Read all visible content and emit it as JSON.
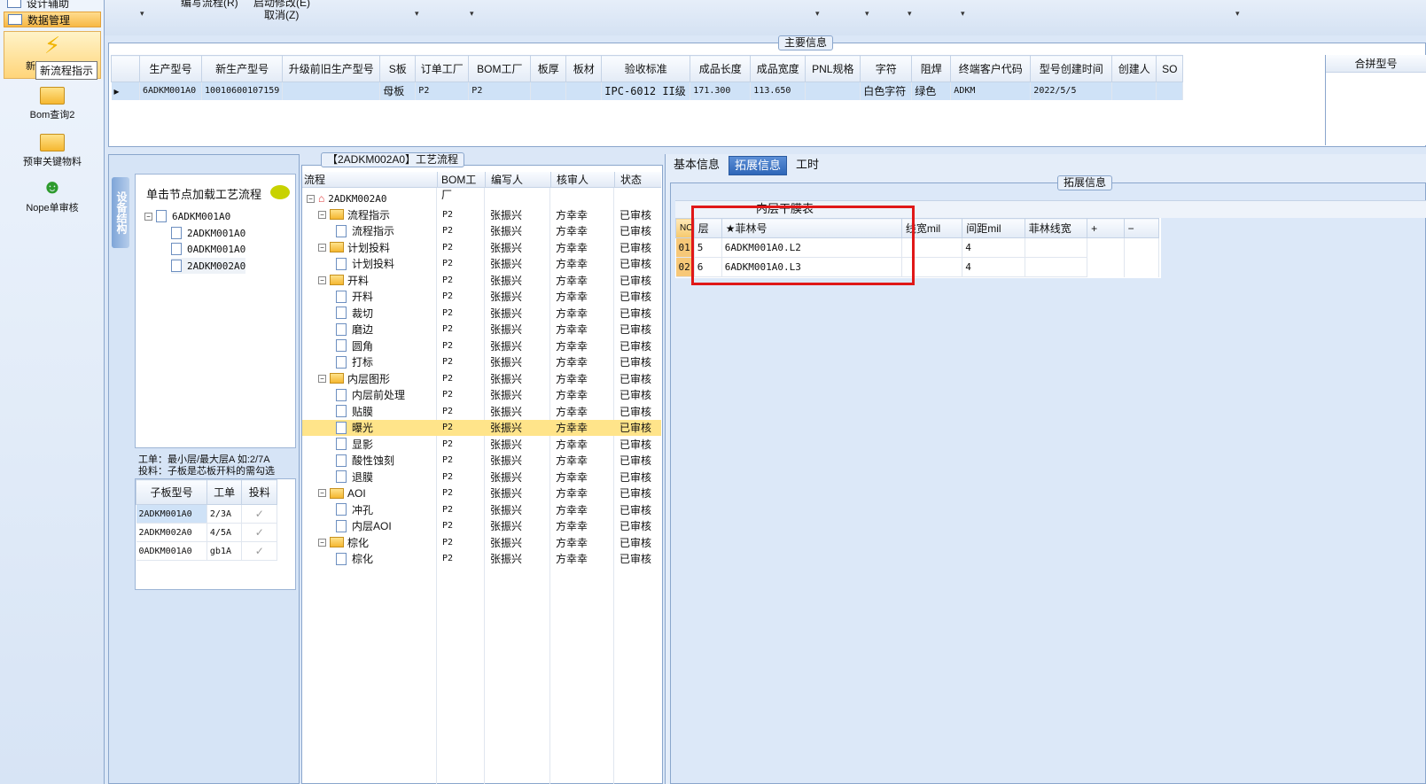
{
  "nav": {
    "top_items": [
      "设计辅助",
      "数据管理"
    ],
    "big_buttons": [
      {
        "label": "新流程指示",
        "icon": "lightning-icon"
      },
      {
        "label": "Bom查询2",
        "icon": "folder-icon"
      },
      {
        "label": "预审关键物料",
        "icon": "folder-icon"
      },
      {
        "label": "Nope单审核",
        "icon": "user-icon"
      }
    ],
    "tooltip": "新流程指示",
    "partial_label": "新"
  },
  "toolbar": {
    "item1": "编写流程(R)",
    "item2": "启动修改(E)",
    "cancel": "取消(Z)"
  },
  "main_info": {
    "title": "主要信息",
    "right_title": "合拼型号",
    "columns": [
      "生产型号",
      "新生产型号",
      "升级前旧生产型号",
      "S板",
      "订单工厂",
      "BOM工厂",
      "板厚",
      "板材",
      "验收标准",
      "成品长度",
      "成品宽度",
      "PNL规格",
      "字符",
      "阻焊",
      "终端客户代码",
      "型号创建时间",
      "创建人",
      "SO"
    ],
    "row": [
      "6ADKM001A0",
      "10010600107159",
      "",
      "母板",
      "P2",
      "P2",
      "",
      "",
      "IPC-6012 II级",
      "171.300",
      "113.650",
      "",
      "白色字符",
      "绿色",
      "ADKM",
      "2022/5/5",
      "",
      ""
    ]
  },
  "device_tree": {
    "side_tab": "设备结构",
    "hint": "单击节点加载工艺流程",
    "root": "6ADKM001A0",
    "children": [
      "2ADKM001A0",
      "0ADKM001A0",
      "2ADKM002A0"
    ],
    "note1": "工单：最小层/最大层A 如:2/7A",
    "note2": "投料：子板是芯板开料的需勾选",
    "sub_columns": [
      "子板型号",
      "工单",
      "投料"
    ],
    "sub_rows": [
      {
        "model": "2ADKM001A0",
        "order": "2/3A",
        "checked": "✓"
      },
      {
        "model": "2ADKM002A0",
        "order": "4/5A",
        "checked": "✓"
      },
      {
        "model": "0ADKM001A0",
        "order": "gb1A",
        "checked": "✓"
      }
    ]
  },
  "process": {
    "title": "【2ADKM002A0】工艺流程",
    "columns": [
      "流程",
      "BOM工厂",
      "编写人",
      "核审人",
      "状态"
    ],
    "root": "2ADKM002A0",
    "rows": [
      {
        "name": "流程指示",
        "level": 1,
        "folder": true,
        "bom": "P2",
        "writer": "张振兴",
        "checker": "方幸幸",
        "status": "已审核"
      },
      {
        "name": "流程指示",
        "level": 2,
        "folder": false,
        "bom": "P2",
        "writer": "张振兴",
        "checker": "方幸幸",
        "status": "已审核"
      },
      {
        "name": "计划投料",
        "level": 1,
        "folder": true,
        "bom": "P2",
        "writer": "张振兴",
        "checker": "方幸幸",
        "status": "已审核"
      },
      {
        "name": "计划投料",
        "level": 2,
        "folder": false,
        "bom": "P2",
        "writer": "张振兴",
        "checker": "方幸幸",
        "status": "已审核"
      },
      {
        "name": "开料",
        "level": 1,
        "folder": true,
        "bom": "P2",
        "writer": "张振兴",
        "checker": "方幸幸",
        "status": "已审核"
      },
      {
        "name": "开料",
        "level": 2,
        "folder": false,
        "bom": "P2",
        "writer": "张振兴",
        "checker": "方幸幸",
        "status": "已审核"
      },
      {
        "name": "裁切",
        "level": 2,
        "folder": false,
        "bom": "P2",
        "writer": "张振兴",
        "checker": "方幸幸",
        "status": "已审核"
      },
      {
        "name": "磨边",
        "level": 2,
        "folder": false,
        "bom": "P2",
        "writer": "张振兴",
        "checker": "方幸幸",
        "status": "已审核"
      },
      {
        "name": "圆角",
        "level": 2,
        "folder": false,
        "bom": "P2",
        "writer": "张振兴",
        "checker": "方幸幸",
        "status": "已审核"
      },
      {
        "name": "打标",
        "level": 2,
        "folder": false,
        "bom": "P2",
        "writer": "张振兴",
        "checker": "方幸幸",
        "status": "已审核"
      },
      {
        "name": "内层图形",
        "level": 1,
        "folder": true,
        "bom": "P2",
        "writer": "张振兴",
        "checker": "方幸幸",
        "status": "已审核"
      },
      {
        "name": "内层前处理",
        "level": 2,
        "folder": false,
        "bom": "P2",
        "writer": "张振兴",
        "checker": "方幸幸",
        "status": "已审核"
      },
      {
        "name": "贴膜",
        "level": 2,
        "folder": false,
        "bom": "P2",
        "writer": "张振兴",
        "checker": "方幸幸",
        "status": "已审核"
      },
      {
        "name": "曝光",
        "level": 2,
        "folder": false,
        "bom": "P2",
        "writer": "张振兴",
        "checker": "方幸幸",
        "status": "已审核",
        "selected": true
      },
      {
        "name": "显影",
        "level": 2,
        "folder": false,
        "bom": "P2",
        "writer": "张振兴",
        "checker": "方幸幸",
        "status": "已审核"
      },
      {
        "name": "酸性蚀刻",
        "level": 2,
        "folder": false,
        "bom": "P2",
        "writer": "张振兴",
        "checker": "方幸幸",
        "status": "已审核"
      },
      {
        "name": "退膜",
        "level": 2,
        "folder": false,
        "bom": "P2",
        "writer": "张振兴",
        "checker": "方幸幸",
        "status": "已审核"
      },
      {
        "name": "AOI",
        "level": 1,
        "folder": true,
        "bom": "P2",
        "writer": "张振兴",
        "checker": "方幸幸",
        "status": "已审核"
      },
      {
        "name": "冲孔",
        "level": 2,
        "folder": false,
        "bom": "P2",
        "writer": "张振兴",
        "checker": "方幸幸",
        "status": "已审核"
      },
      {
        "name": "内层AOI",
        "level": 2,
        "folder": false,
        "bom": "P2",
        "writer": "张振兴",
        "checker": "方幸幸",
        "status": "已审核"
      },
      {
        "name": "棕化",
        "level": 1,
        "folder": true,
        "bom": "P2",
        "writer": "张振兴",
        "checker": "方幸幸",
        "status": "已审核"
      },
      {
        "name": "棕化",
        "level": 2,
        "folder": false,
        "bom": "P2",
        "writer": "张振兴",
        "checker": "方幸幸",
        "status": "已审核"
      }
    ]
  },
  "detail": {
    "tabs": [
      "基本信息",
      "拓展信息",
      "工时"
    ],
    "active_tab": 1,
    "group_title": "拓展信息",
    "table_title": "内层干膜表",
    "columns": [
      "NO",
      "层",
      "★菲林号",
      "线宽mil",
      "间距mil",
      "菲林线宽",
      "+",
      "−"
    ],
    "rows": [
      {
        "no": "01",
        "layer": "5",
        "film": "6ADKM001A0.L2",
        "lw": "",
        "sp": "4",
        "flw": ""
      },
      {
        "no": "02",
        "layer": "6",
        "film": "6ADKM001A0.L3",
        "lw": "",
        "sp": "4",
        "flw": ""
      }
    ],
    "highlight_color": "#e01818"
  }
}
